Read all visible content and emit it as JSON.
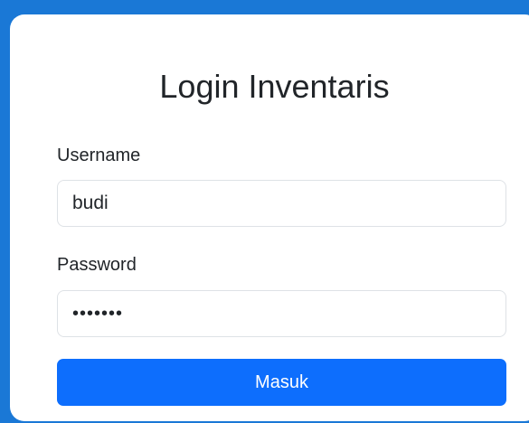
{
  "login": {
    "title": "Login Inventaris",
    "username_label": "Username",
    "username_value": "budi",
    "password_label": "Password",
    "password_value": "•••••••",
    "submit_label": "Masuk"
  },
  "colors": {
    "background": "#1a78d6",
    "primary": "#0d6efd",
    "card": "#ffffff"
  }
}
